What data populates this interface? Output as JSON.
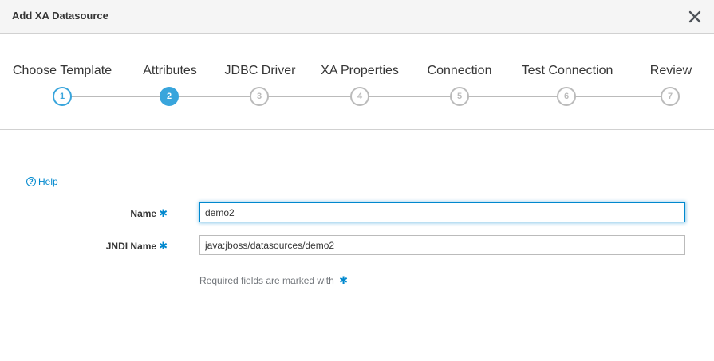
{
  "dialog": {
    "title": "Add XA Datasource",
    "close_icon": "×"
  },
  "steps": [
    {
      "label": "Choose Template",
      "number": "1",
      "state": "done"
    },
    {
      "label": "Attributes",
      "number": "2",
      "state": "active"
    },
    {
      "label": "JDBC Driver",
      "number": "3",
      "state": "pending"
    },
    {
      "label": "XA Properties",
      "number": "4",
      "state": "pending"
    },
    {
      "label": "Connection",
      "number": "5",
      "state": "pending"
    },
    {
      "label": "Test Connection",
      "number": "6",
      "state": "pending"
    },
    {
      "label": "Review",
      "number": "7",
      "state": "pending"
    }
  ],
  "help": {
    "icon": "?",
    "label": "Help"
  },
  "form": {
    "name_label": "Name",
    "name_value": "demo2",
    "jndi_label": "JNDI Name",
    "jndi_value": "java:jboss/datasources/demo2",
    "required_marker": "✱",
    "required_note": "Required fields are marked with"
  },
  "colors": {
    "accent": "#39a5dc",
    "link": "#0088ce",
    "inactive": "#bbbbbb"
  }
}
